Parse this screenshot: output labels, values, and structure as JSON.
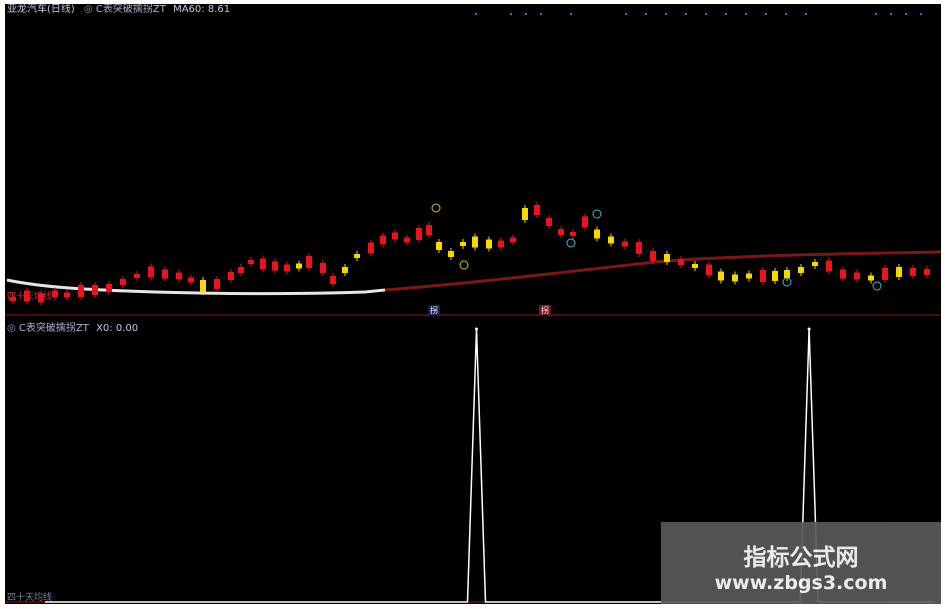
{
  "top_panel": {
    "title": "亚龙汽车(日线)",
    "indicator": "C表突破擒拐ZT",
    "ma_label": "MA60:",
    "ma_value": "8.61",
    "bottom_label": "四十天均线",
    "markers": [
      "拐",
      "拐"
    ]
  },
  "bottom_panel": {
    "indicator": "C表突破擒拐ZT",
    "x_label": "X0:",
    "x_value": "0.00",
    "footer_label": "四十天均线"
  },
  "watermark": {
    "title": "指标公式网",
    "url": "www.zbgs3.com"
  },
  "colors": {
    "background": "#000000",
    "up_candle": "#e8141e",
    "flat_candle": "#f5d800",
    "ma_line": "#8a1a1a",
    "long_ma_line": "#ffffff",
    "signal_line": "#ffffff",
    "header_text": "#b8b8d8",
    "accent": "#e8141e"
  },
  "chart_data": {
    "type": "line",
    "series": [
      {
        "values": [
          0,
          0,
          0,
          0,
          0,
          0,
          0,
          0,
          0,
          0,
          0,
          0,
          0,
          0,
          0,
          0,
          0,
          0,
          0,
          0,
          0,
          0,
          0,
          0,
          0,
          0,
          0,
          0,
          0,
          0,
          0,
          0,
          0,
          0,
          0,
          0,
          0,
          0,
          0,
          0,
          0,
          0,
          0,
          0,
          0,
          0,
          0,
          0,
          1,
          0,
          0,
          0,
          0,
          0,
          0,
          0,
          0,
          0,
          0,
          0,
          0,
          0,
          0,
          0,
          0,
          0,
          0,
          0,
          0,
          0,
          0,
          0,
          0,
          0,
          0,
          0,
          0,
          0,
          0,
          0,
          0,
          0,
          0,
          0,
          0,
          1,
          0,
          0,
          0,
          0,
          0,
          0,
          0,
          0,
          0,
          0,
          0,
          0,
          0,
          0
        ]
      }
    ]
  }
}
